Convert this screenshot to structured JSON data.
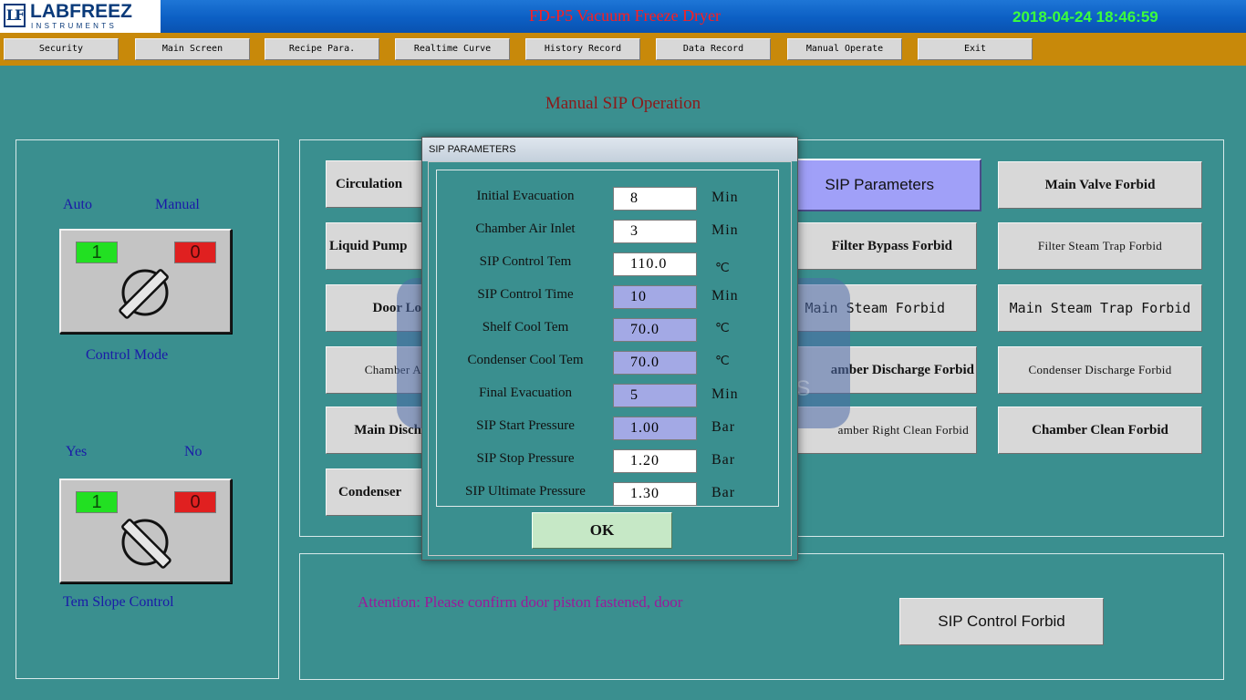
{
  "header": {
    "logo_mark": "LF",
    "logo_brand": "LABFREEZ",
    "logo_sub": "INSTRUMENTS",
    "title": "FD-P5 Vacuum Freeze Dryer",
    "datetime": "2018-04-24 18:46:59"
  },
  "nav": [
    {
      "label": "Security"
    },
    {
      "label": "Main Screen"
    },
    {
      "label": "Recipe Para."
    },
    {
      "label": "Realtime Curve"
    },
    {
      "label": "History Record"
    },
    {
      "label": "Data Record"
    },
    {
      "label": "Manual Operate"
    },
    {
      "label": "Exit"
    }
  ],
  "page_title": "Manual SIP Operation",
  "control_mode": {
    "label_left": "Auto",
    "label_right": "Manual",
    "green_indicator": "1",
    "red_indicator": "0",
    "caption": "Control Mode"
  },
  "tem_slope": {
    "label_left": "Yes",
    "label_right": "No",
    "green_indicator": "1",
    "red_indicator": "0",
    "caption": "Tem Slope Control"
  },
  "left_column_buttons": [
    {
      "label": "Circulation"
    },
    {
      "label": "Liquid Pump"
    },
    {
      "label": "Door Lo"
    },
    {
      "label": "Chamber A"
    },
    {
      "label": "Main Disch"
    },
    {
      "label": "Condenser"
    }
  ],
  "middle_column_buttons": [
    {
      "label": "SIP Parameters"
    },
    {
      "label": "Filter Bypass Forbid"
    },
    {
      "label": "Main Steam Forbid"
    },
    {
      "label": "amber Discharge Forbid"
    },
    {
      "label": "amber Right Clean Forbid"
    }
  ],
  "right_column_buttons": [
    {
      "label": "Main Valve Forbid"
    },
    {
      "label": "Filter Steam Trap Forbid"
    },
    {
      "label": "Main Steam Trap Forbid"
    },
    {
      "label": "Condenser Discharge Forbid"
    },
    {
      "label": "Chamber Clean Forbid"
    }
  ],
  "attention_text": "Attention: Please confirm door piston fastened, door",
  "sip_control_forbid": "SIP Control Forbid",
  "watermark": {
    "brand": "LABFREEZ",
    "sub": "INSTRUMENTS"
  },
  "dialog": {
    "title": "SIP PARAMETERS",
    "ok_label": "OK",
    "params": [
      {
        "label": "Initial Evacuation",
        "value": "8",
        "unit": "Min"
      },
      {
        "label": "Chamber Air Inlet",
        "value": "3",
        "unit": "Min"
      },
      {
        "label": "SIP Control Tem",
        "value": "110.0",
        "unit": "℃"
      },
      {
        "label": "SIP Control Time",
        "value": "10",
        "unit": "Min"
      },
      {
        "label": "Shelf Cool Tem",
        "value": "70.0",
        "unit": "℃"
      },
      {
        "label": "Condenser Cool Tem",
        "value": "70.0",
        "unit": "℃"
      },
      {
        "label": "Final Evacuation",
        "value": "5",
        "unit": "Min"
      },
      {
        "label": "SIP Start Pressure",
        "value": "1.00",
        "unit": "Bar"
      },
      {
        "label": "SIP Stop Pressure",
        "value": "1.20",
        "unit": "Bar"
      },
      {
        "label": "SIP Ultimate Pressure",
        "value": "1.30",
        "unit": "Bar"
      }
    ]
  },
  "colors": {
    "background": "#3a8f8f",
    "header_blue": "#0c5fc4",
    "nav_orange": "#c8890a",
    "title_red": "#ff1e1e",
    "datetime_green": "#3cff3c",
    "label_blue": "#1a1aa8",
    "attention_purple": "#9a1a9a",
    "sip_params_button": "#a0a0f8"
  }
}
